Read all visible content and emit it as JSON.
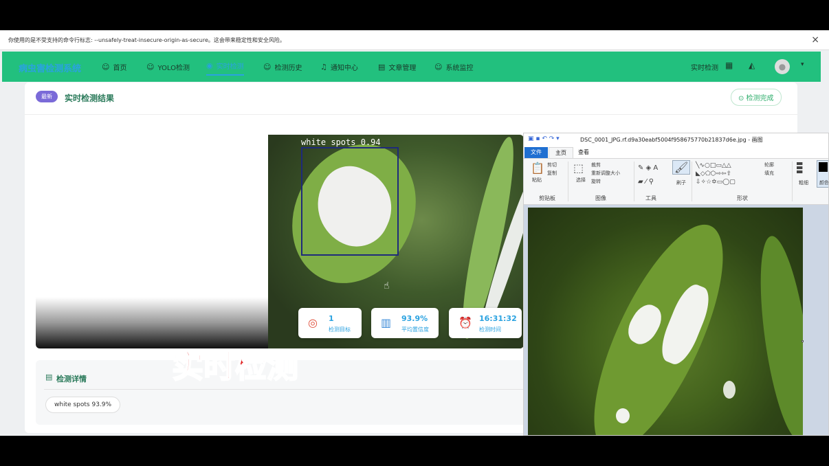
{
  "browser": {
    "warning": "你使用的是不受支持的命令行标志: --unsafely-treat-insecure-origin-as-secure。这会带来稳定性和安全风险。",
    "close_icon": "×"
  },
  "nav": {
    "brand": "病虫害检测系统",
    "items": [
      {
        "icon": "☺",
        "label": "首页"
      },
      {
        "icon": "☺",
        "label": "YOLO检测"
      },
      {
        "icon": "◉",
        "label": "实时检测"
      },
      {
        "icon": "☺",
        "label": "检测历史"
      },
      {
        "icon": "♫",
        "label": "通知中心"
      },
      {
        "icon": "▤",
        "label": "文章管理"
      },
      {
        "icon": "☺",
        "label": "系统监控"
      }
    ],
    "right_label": "实时检测",
    "avatar": "●"
  },
  "result": {
    "badge": "最新",
    "title": "实时检测结果",
    "status": "⊙ 检测完成",
    "detection_label": "white spots 0.94",
    "stats": [
      {
        "icon": "◎",
        "value": "1",
        "label": "检测目标"
      },
      {
        "icon": "▥",
        "value": "93.9%",
        "label": "平均置信度"
      },
      {
        "icon": "⏰",
        "value": "16:31:32",
        "label": "检测时间"
      }
    ]
  },
  "details": {
    "title": "检测详情",
    "chip": "white spots  93.9%"
  },
  "overlay_text": "实时检测",
  "paint": {
    "title": "DSC_0001_JPG.rf.d9a30eabf5004f958675770b21837d6e.jpg - 画图",
    "tabs": [
      "文件",
      "主页",
      "查看"
    ],
    "clipboard": {
      "paste": "粘贴",
      "cut": "剪切",
      "copy": "复制",
      "group": "剪贴板"
    },
    "image": {
      "select": "选择",
      "crop": "裁剪",
      "resize": "重新调整大小",
      "rotate": "旋转",
      "group": "图像"
    },
    "tools": {
      "group": "工具",
      "brush": "刷子"
    },
    "shapes": {
      "group": "形状",
      "outline": "轮廓",
      "fill": "填充"
    },
    "size": "粗细",
    "color": "颜色"
  },
  "colors": {
    "header": "#22c07e",
    "accent": "#2aa2e0",
    "badge": "#7a6ad8",
    "overlay": "#e02020"
  }
}
